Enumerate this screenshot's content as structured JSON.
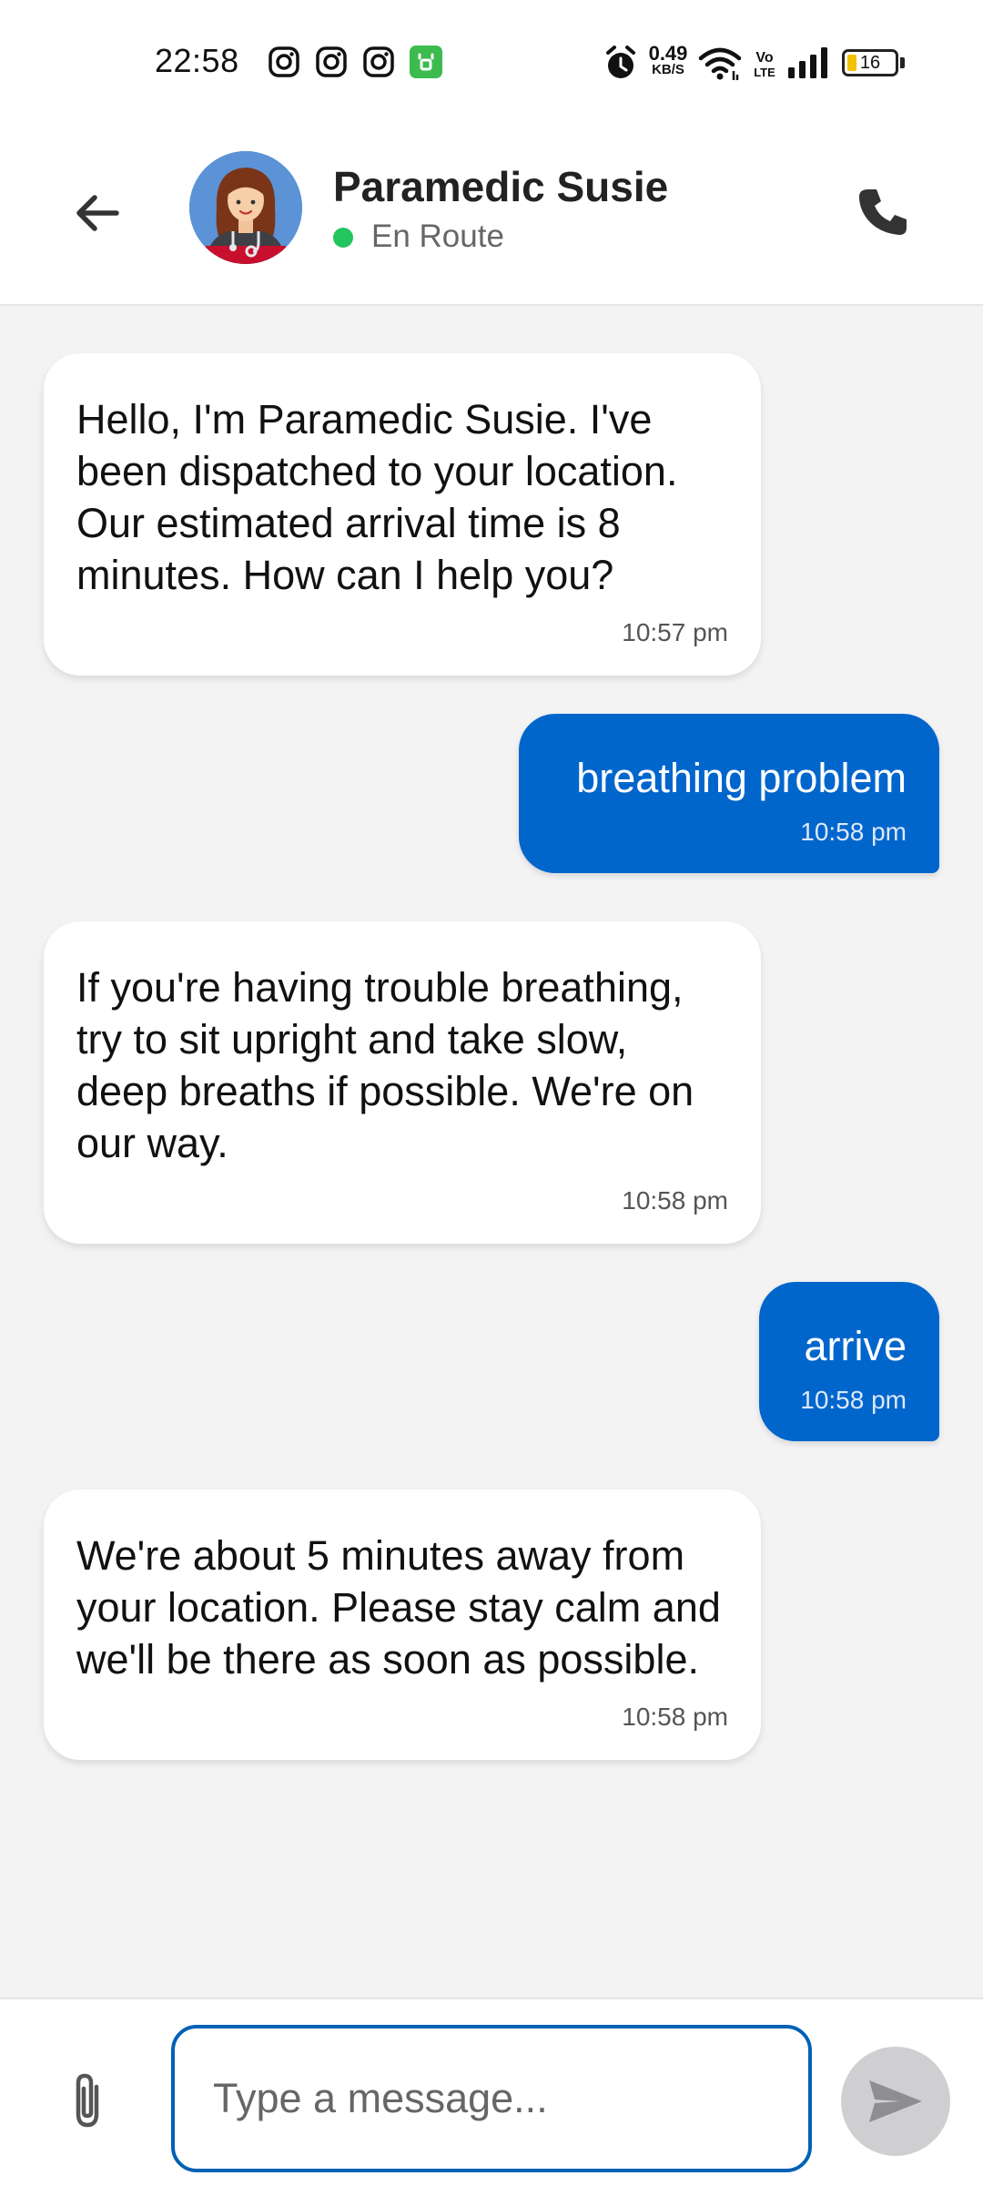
{
  "status_bar": {
    "time": "22:58",
    "app_icons": [
      "instagram-icon",
      "instagram-icon",
      "instagram-icon",
      "store-icon"
    ],
    "net_speed_value": "0.49",
    "net_speed_unit": "KB/S",
    "volte_label_top": "Vo",
    "volte_label_bottom": "LTE",
    "battery_level": "16",
    "icons": [
      "alarm-icon",
      "wifi-icon",
      "volte-icon",
      "signal-icon",
      "battery-icon"
    ]
  },
  "header": {
    "contact_name": "Paramedic Susie",
    "contact_status": "En Route",
    "status_color": "#22c55e",
    "back_icon": "arrow-left-icon",
    "call_icon": "phone-icon"
  },
  "messages": [
    {
      "direction": "incoming",
      "text": "Hello, I'm Paramedic Susie. I've been dispatched to your location. Our estimated arrival time is 8 minutes. How can I help you?",
      "time": "10:57 pm"
    },
    {
      "direction": "outgoing",
      "text": "breathing problem",
      "time": "10:58 pm"
    },
    {
      "direction": "incoming",
      "text": "If you're having trouble breathing, try to sit upright and take slow, deep breaths if possible. We're on our way.",
      "time": "10:58 pm"
    },
    {
      "direction": "outgoing",
      "text": "arrive",
      "time": "10:58 pm"
    },
    {
      "direction": "incoming",
      "text": "We're about 5 minutes away from your location. Please stay calm and we'll be there as soon as possible.",
      "time": "10:58 pm"
    }
  ],
  "composer": {
    "placeholder": "Type a message...",
    "value": "",
    "attach_icon": "paperclip-icon",
    "send_icon": "send-icon"
  },
  "colors": {
    "accent": "#0066cc",
    "background": "#f3f3f4",
    "incoming_bubble": "#ffffff",
    "outgoing_bubble": "#0066cc",
    "send_button_disabled": "#cfcfd1"
  }
}
